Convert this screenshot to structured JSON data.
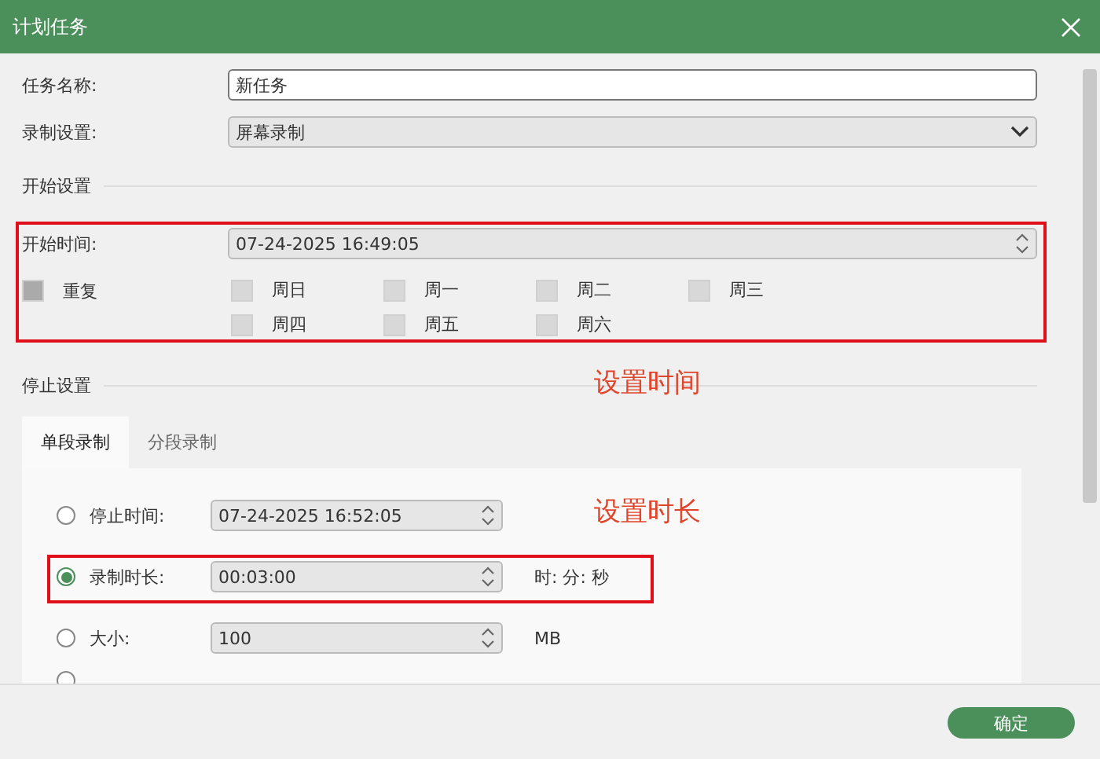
{
  "window": {
    "title": "计划任务"
  },
  "task_name": {
    "label": "任务名称:",
    "value": "新任务"
  },
  "record_setting": {
    "label": "录制设置:",
    "value": "屏幕录制"
  },
  "start_settings": {
    "heading": "开始设置",
    "time_label": "开始时间:",
    "time_value": "07-24-2025 16:49:05",
    "repeat": {
      "label": "重复",
      "checked": false,
      "disabled": true
    },
    "days": [
      {
        "label": "周日",
        "checked": false
      },
      {
        "label": "周一",
        "checked": false
      },
      {
        "label": "周二",
        "checked": false
      },
      {
        "label": "周三",
        "checked": false
      },
      {
        "label": "周四",
        "checked": false
      },
      {
        "label": "周五",
        "checked": false
      },
      {
        "label": "周六",
        "checked": false
      }
    ]
  },
  "stop_settings": {
    "heading": "停止设置",
    "tabs": [
      {
        "label": "单段录制",
        "selected": true
      },
      {
        "label": "分段录制",
        "selected": false
      }
    ],
    "options": [
      {
        "label": "停止时间:",
        "selected": false,
        "value": "07-24-2025 16:52:05"
      },
      {
        "label": "录制时长:",
        "selected": true,
        "value": "00:03:00",
        "unit": "时: 分: 秒"
      },
      {
        "label": "大小:",
        "selected": false,
        "value": "100",
        "unit": "MB"
      },
      {
        "selected": false
      }
    ]
  },
  "annotations": [
    {
      "text": "设置时间"
    },
    {
      "text": "设置时长"
    }
  ],
  "buttons": [
    {
      "label": "确定"
    }
  ]
}
